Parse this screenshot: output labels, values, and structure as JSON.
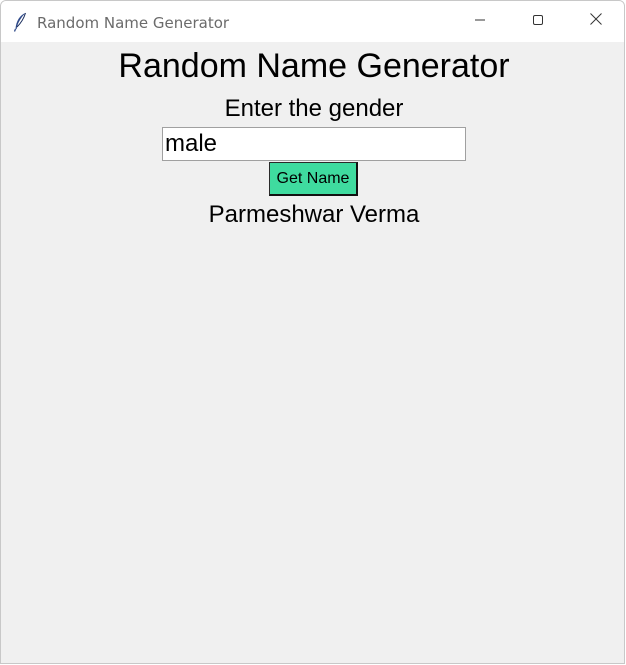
{
  "window": {
    "title": "Random Name Generator",
    "controls": {
      "minimize": "minimize-icon",
      "maximize": "maximize-icon",
      "close": "close-icon"
    }
  },
  "main": {
    "heading": "Random Name Generator",
    "prompt": "Enter the gender",
    "gender_input": {
      "value": "male",
      "placeholder": ""
    },
    "get_button_label": "Get Name",
    "result": "Parmeshwar Verma"
  },
  "colors": {
    "button_bg": "#3fdb9f",
    "window_bg": "#f0f0f0"
  }
}
